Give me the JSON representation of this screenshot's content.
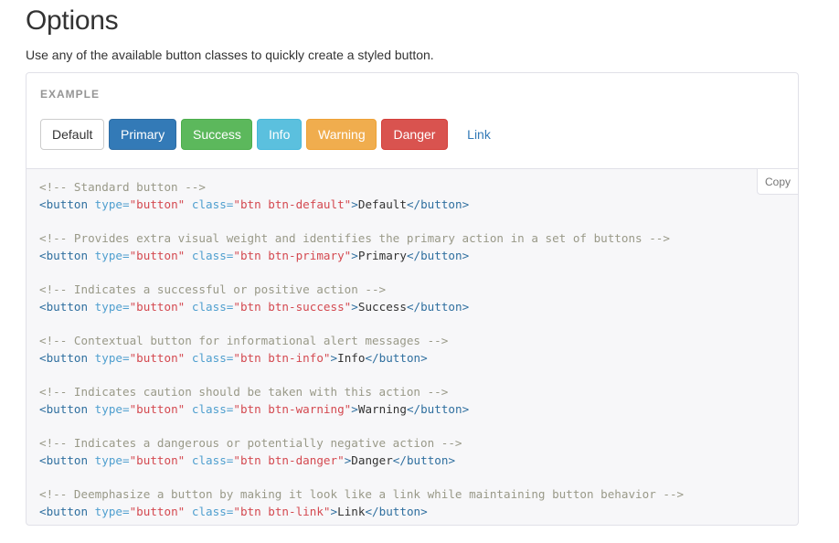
{
  "header": {
    "title": "Options",
    "lead": "Use any of the available button classes to quickly create a styled button."
  },
  "example": {
    "label": "EXAMPLE",
    "buttons": [
      {
        "label": "Default",
        "style": "default",
        "color": "#ffffff"
      },
      {
        "label": "Primary",
        "style": "primary",
        "color": "#337ab7"
      },
      {
        "label": "Success",
        "style": "success",
        "color": "#5cb85c"
      },
      {
        "label": "Info",
        "style": "info",
        "color": "#5bc0de"
      },
      {
        "label": "Warning",
        "style": "warning",
        "color": "#f0ad4e"
      },
      {
        "label": "Danger",
        "style": "danger",
        "color": "#d9534f"
      },
      {
        "label": "Link",
        "style": "link",
        "color": "#337ab7"
      }
    ]
  },
  "code": {
    "copy_label": "Copy",
    "snippets": [
      {
        "comment": "<!-- Standard button -->",
        "tag_open": "<button",
        "type_attr": "type=",
        "type_val": "\"button\"",
        "class_attr": "class=",
        "class_val": "\"btn btn-default\"",
        "gt": ">",
        "text": "Default",
        "tag_close": "</button>"
      },
      {
        "comment": "<!-- Provides extra visual weight and identifies the primary action in a set of buttons -->",
        "tag_open": "<button",
        "type_attr": "type=",
        "type_val": "\"button\"",
        "class_attr": "class=",
        "class_val": "\"btn btn-primary\"",
        "gt": ">",
        "text": "Primary",
        "tag_close": "</button>"
      },
      {
        "comment": "<!-- Indicates a successful or positive action -->",
        "tag_open": "<button",
        "type_attr": "type=",
        "type_val": "\"button\"",
        "class_attr": "class=",
        "class_val": "\"btn btn-success\"",
        "gt": ">",
        "text": "Success",
        "tag_close": "</button>"
      },
      {
        "comment": "<!-- Contextual button for informational alert messages -->",
        "tag_open": "<button",
        "type_attr": "type=",
        "type_val": "\"button\"",
        "class_attr": "class=",
        "class_val": "\"btn btn-info\"",
        "gt": ">",
        "text": "Info",
        "tag_close": "</button>"
      },
      {
        "comment": "<!-- Indicates caution should be taken with this action -->",
        "tag_open": "<button",
        "type_attr": "type=",
        "type_val": "\"button\"",
        "class_attr": "class=",
        "class_val": "\"btn btn-warning\"",
        "gt": ">",
        "text": "Warning",
        "tag_close": "</button>"
      },
      {
        "comment": "<!-- Indicates a dangerous or potentially negative action -->",
        "tag_open": "<button",
        "type_attr": "type=",
        "type_val": "\"button\"",
        "class_attr": "class=",
        "class_val": "\"btn btn-danger\"",
        "gt": ">",
        "text": "Danger",
        "tag_close": "</button>"
      },
      {
        "comment": "<!-- Deemphasize a button by making it look like a link while maintaining button behavior -->",
        "tag_open": "<button",
        "type_attr": "type=",
        "type_val": "\"button\"",
        "class_attr": "class=",
        "class_val": "\"btn btn-link\"",
        "gt": ">",
        "text": "Link",
        "tag_close": "</button>"
      }
    ]
  }
}
